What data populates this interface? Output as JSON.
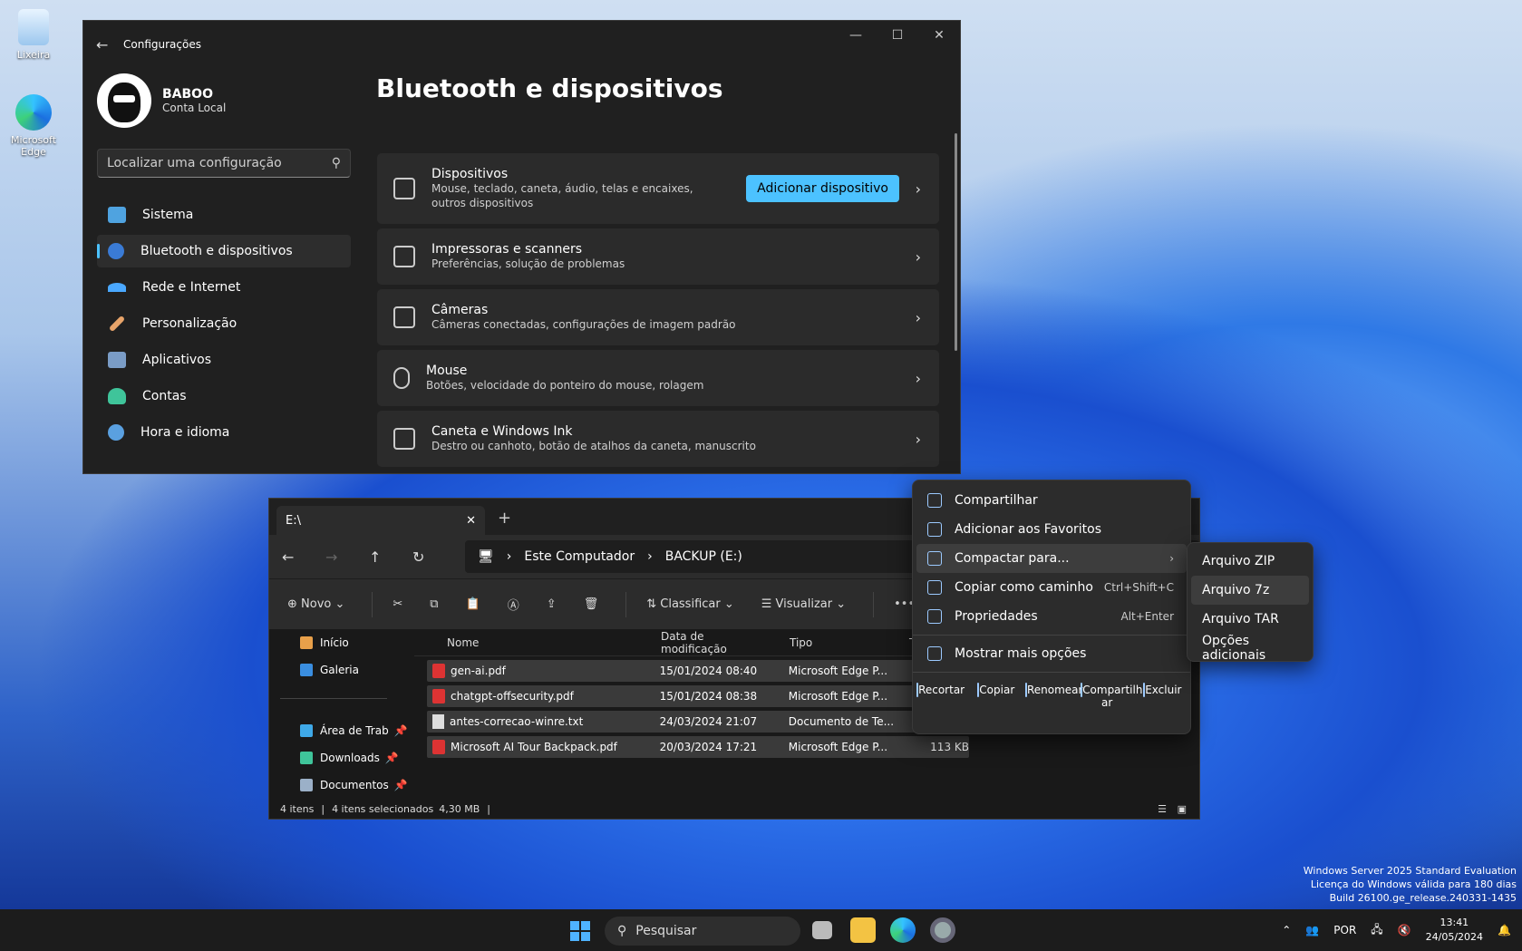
{
  "desktop": {
    "icons": [
      {
        "label": "Lixeira",
        "icon": "recycle-bin-icon"
      },
      {
        "label": "Microsoft Edge",
        "icon": "edge-icon"
      }
    ],
    "watermark": [
      "Windows Server 2025 Standard Evaluation",
      "Licença do Windows válida para 180 dias",
      "Build 26100.ge_release.240331-1435"
    ]
  },
  "settings": {
    "title": "Configurações",
    "user": {
      "name": "BABOO",
      "account": "Conta Local"
    },
    "search_placeholder": "Localizar uma configuração",
    "nav": [
      {
        "label": "Sistema",
        "color": "#4fa3e0"
      },
      {
        "label": "Bluetooth e dispositivos",
        "color": "#3a7bd5",
        "selected": true
      },
      {
        "label": "Rede e Internet",
        "color": "#4aa8ff"
      },
      {
        "label": "Personalização",
        "color": "#e8a46a"
      },
      {
        "label": "Aplicativos",
        "color": "#7a9cc6"
      },
      {
        "label": "Contas",
        "color": "#3fc49a"
      },
      {
        "label": "Hora e idioma",
        "color": "#5aa0e0"
      }
    ],
    "heading": "Bluetooth e dispositivos",
    "cards": [
      {
        "title": "Dispositivos",
        "desc": "Mouse, teclado, caneta, áudio, telas e encaixes, outros dispositivos",
        "button": "Adicionar dispositivo"
      },
      {
        "title": "Impressoras e scanners",
        "desc": "Preferências, solução de problemas"
      },
      {
        "title": "Câmeras",
        "desc": "Câmeras conectadas, configurações de imagem padrão"
      },
      {
        "title": "Mouse",
        "desc": "Botões, velocidade do ponteiro do mouse, rolagem"
      },
      {
        "title": "Caneta e Windows Ink",
        "desc": "Destro ou canhoto, botão de atalhos da caneta, manuscrito"
      }
    ]
  },
  "explorer": {
    "tab": "E:\\",
    "breadcrumb": [
      "Este Computador",
      "BACKUP (E:)"
    ],
    "toolbar": {
      "new": "Novo",
      "sort": "Classificar",
      "view": "Visualizar"
    },
    "sidebar": [
      "Início",
      "Galeria",
      "Área de Trab",
      "Downloads",
      "Documentos"
    ],
    "columns": [
      "Nome",
      "Data de modificação",
      "Tipo",
      "T"
    ],
    "files": [
      {
        "name": "gen-ai.pdf",
        "date": "15/01/2024 08:40",
        "type": "Microsoft Edge P...",
        "size": "",
        "kind": "pdf"
      },
      {
        "name": "chatgpt-offsecurity.pdf",
        "date": "15/01/2024 08:38",
        "type": "Microsoft Edge P...",
        "size": "",
        "kind": "pdf"
      },
      {
        "name": "antes-correcao-winre.txt",
        "date": "24/03/2024 21:07",
        "type": "Documento de Te...",
        "size": "",
        "kind": "txt"
      },
      {
        "name": "Microsoft AI Tour Backpack.pdf",
        "date": "20/03/2024 17:21",
        "type": "Microsoft Edge P...",
        "size": "113 KB",
        "kind": "pdf"
      }
    ],
    "status": {
      "count": "4 itens",
      "selected": "4 itens selecionados",
      "size": "4,30 MB"
    }
  },
  "context_menu": {
    "items": [
      {
        "label": "Compartilhar"
      },
      {
        "label": "Adicionar aos Favoritos"
      },
      {
        "label": "Compactar para...",
        "highlighted": true
      },
      {
        "label": "Copiar como caminho",
        "shortcut": "Ctrl+Shift+C"
      },
      {
        "label": "Propriedades",
        "shortcut": "Alt+Enter"
      },
      {
        "label": "Mostrar mais opções"
      }
    ],
    "actions": [
      "Recortar",
      "Copiar",
      "Renomear",
      "Compartilh ar",
      "Excluir"
    ],
    "submenu": [
      "Arquivo ZIP",
      "Arquivo 7z",
      "Arquivo TAR",
      "Opções adicionais"
    ]
  },
  "taskbar": {
    "search": "Pesquisar",
    "lang": "POR",
    "time": "13:41",
    "date": "24/05/2024"
  }
}
